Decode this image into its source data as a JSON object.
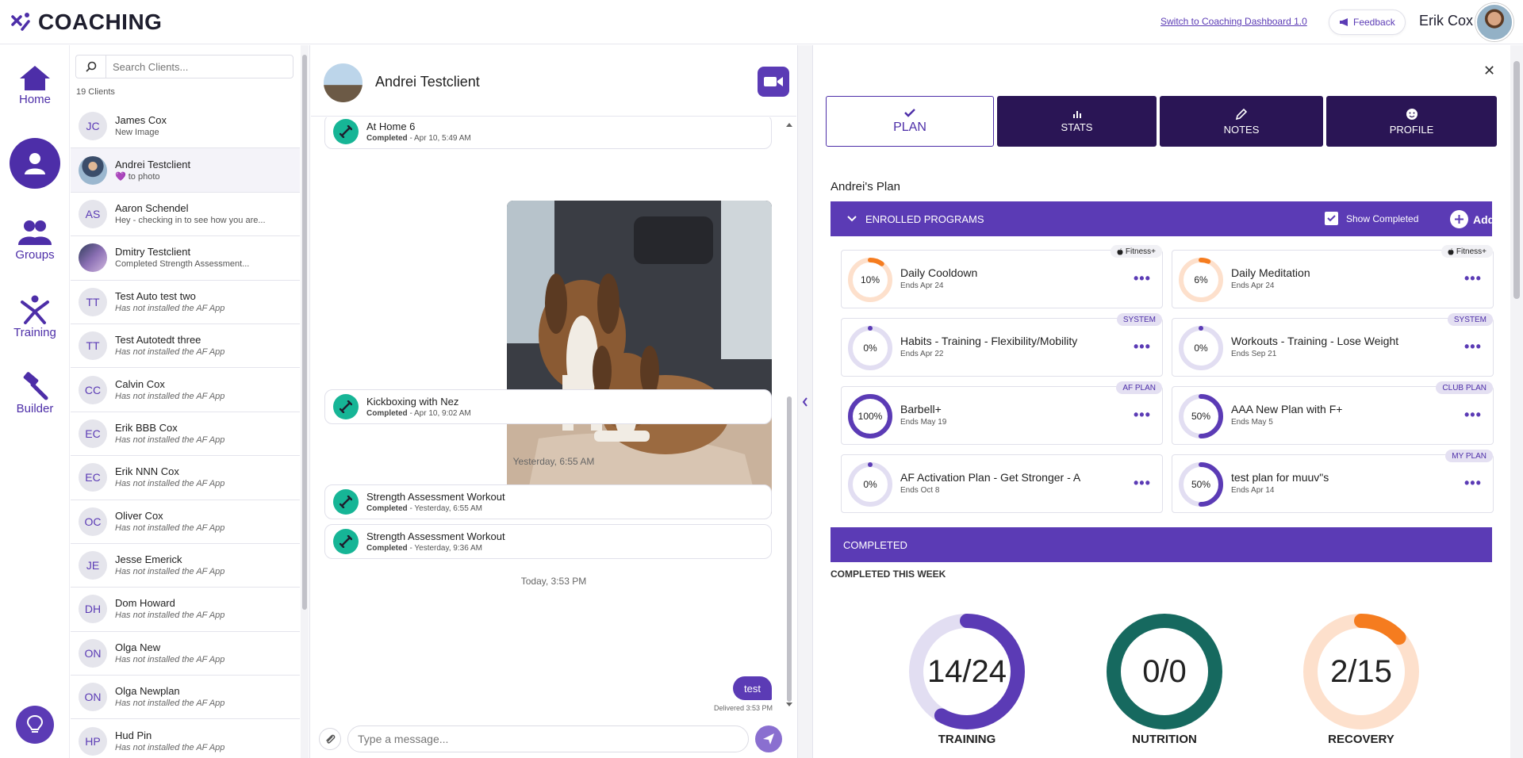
{
  "app": {
    "logo_text": "COACHING",
    "switch_link": "Switch to Coaching Dashboard 1.0",
    "feedback_label": "Feedback",
    "user_name": "Erik Cox"
  },
  "nav": {
    "home": "Home",
    "groups": "Groups",
    "training": "Training",
    "builder": "Builder"
  },
  "clients": {
    "search_placeholder": "Search Clients...",
    "count_label": "19 Clients",
    "items": [
      {
        "initials": "JC",
        "name": "James Cox",
        "sub": "New Image",
        "italic": false
      },
      {
        "initials": "",
        "name": "Andrei Testclient",
        "sub": "💜 to photo",
        "italic": false
      },
      {
        "initials": "AS",
        "name": "Aaron Schendel",
        "sub": "Hey - checking in to see how you are...",
        "italic": false
      },
      {
        "initials": "",
        "name": "Dmitry Testclient",
        "sub": "Completed Strength Assessment...",
        "italic": false
      },
      {
        "initials": "TT",
        "name": "Test Auto test two",
        "sub": "Has not installed the AF App",
        "italic": true
      },
      {
        "initials": "TT",
        "name": "Test Autotedt three",
        "sub": "Has not installed the AF App",
        "italic": true
      },
      {
        "initials": "CC",
        "name": "Calvin Cox",
        "sub": "Has not installed the AF App",
        "italic": true
      },
      {
        "initials": "EC",
        "name": "Erik BBB Cox",
        "sub": "Has not installed the AF App",
        "italic": true
      },
      {
        "initials": "EC",
        "name": "Erik NNN Cox",
        "sub": "Has not installed the AF App",
        "italic": true
      },
      {
        "initials": "OC",
        "name": "Oliver Cox",
        "sub": "Has not installed the AF App",
        "italic": true
      },
      {
        "initials": "JE",
        "name": "Jesse Emerick",
        "sub": "Has not installed the AF App",
        "italic": true
      },
      {
        "initials": "DH",
        "name": "Dom Howard",
        "sub": "Has not installed the AF App",
        "italic": true
      },
      {
        "initials": "ON",
        "name": "Olga New",
        "sub": "Has not installed the AF App",
        "italic": true
      },
      {
        "initials": "ON",
        "name": "Olga Newplan",
        "sub": "Has not installed the AF App",
        "italic": true
      },
      {
        "initials": "HP",
        "name": "Hud Pin",
        "sub": "Has not installed the AF App",
        "italic": true
      }
    ]
  },
  "chat": {
    "client_name": "Andrei Testclient",
    "cards": [
      {
        "title": "At Home 6",
        "status": "Completed",
        "when": " - Apr 10, 5:49 AM"
      },
      {
        "title": "Kickboxing with Nez",
        "status": "Completed",
        "when": " - Apr 10, 9:02 AM"
      },
      {
        "title": "Strength Assessment Workout",
        "status": "Completed",
        "when": " - Yesterday, 6:55 AM"
      },
      {
        "title": "Strength Assessment Workout",
        "status": "Completed",
        "when": " - Yesterday, 9:36 AM"
      }
    ],
    "ts_yesterday": "Yesterday, 6:55 AM",
    "ts_today": "Today, 3:53 PM",
    "message": "test",
    "delivered": "Delivered 3:53 PM",
    "input_placeholder": "Type a message..."
  },
  "plan": {
    "tabs": [
      {
        "label": "PLAN",
        "icon": "check-icon"
      },
      {
        "label": "STATS",
        "icon": "bar-chart-icon"
      },
      {
        "label": "NOTES",
        "icon": "pencil-icon"
      },
      {
        "label": "PROFILE",
        "icon": "smile-icon"
      }
    ],
    "title": "Andrei's Plan",
    "enrolled_label": "ENROLLED PROGRAMS",
    "show_completed_label": "Show Completed",
    "add_label": "Add",
    "programs": [
      {
        "name": "Daily Cooldown",
        "ends": "Ends Apr 24",
        "pct_label": "10%",
        "progress": 0.1,
        "badge": "Fitness+",
        "apple": true,
        "color": "#f57c1f",
        "track": "#fde0cc"
      },
      {
        "name": "Daily Meditation",
        "ends": "Ends Apr 24",
        "pct_label": "6%",
        "progress": 0.06,
        "badge": "Fitness+",
        "apple": true,
        "color": "#f57c1f",
        "track": "#fde0cc"
      },
      {
        "name": "Habits - Training - Flexibility/Mobility",
        "ends": "Ends Apr 22",
        "pct_label": "0%",
        "progress": 0,
        "badge": "SYSTEM",
        "apple": false,
        "color": "#5b3bb5",
        "track": "#e2def2"
      },
      {
        "name": "Workouts - Training - Lose Weight",
        "ends": "Ends Sep 21",
        "pct_label": "0%",
        "progress": 0,
        "badge": "SYSTEM",
        "apple": false,
        "color": "#5b3bb5",
        "track": "#e2def2"
      },
      {
        "name": "Barbell+",
        "ends": "Ends May 19",
        "pct_label": "100%",
        "progress": 1.0,
        "badge": "AF PLAN",
        "apple": false,
        "color": "#5b3bb5",
        "track": "#e2def2"
      },
      {
        "name": "AAA New Plan with F+",
        "ends": "Ends May 5",
        "pct_label": "50%",
        "progress": 0.5,
        "badge": "CLUB PLAN",
        "apple": false,
        "color": "#5b3bb5",
        "track": "#e2def2"
      },
      {
        "name": "AF Activation Plan - Get Stronger - A",
        "ends": "Ends Oct 8",
        "pct_label": "0%",
        "progress": 0,
        "badge": "",
        "apple": false,
        "color": "#5b3bb5",
        "track": "#e2def2"
      },
      {
        "name": "test plan for muuv\"s",
        "ends": "Ends Apr 14",
        "pct_label": "50%",
        "progress": 0.5,
        "badge": "MY PLAN",
        "apple": false,
        "color": "#5b3bb5",
        "track": "#e2def2"
      }
    ],
    "completed_label": "COMPLETED",
    "completed_week_label": "COMPLETED THIS WEEK",
    "stats": [
      {
        "label": "TRAINING",
        "value": "14/24",
        "done": 14,
        "total": 24,
        "color": "#5b3bb5",
        "track": "#e2def2"
      },
      {
        "label": "NUTRITION",
        "value": "0/0",
        "done": 0,
        "total": 0,
        "color": "#16695f",
        "track": "#16695f"
      },
      {
        "label": "RECOVERY",
        "value": "2/15",
        "done": 2,
        "total": 15,
        "color": "#f57c1f",
        "track": "#fde0cc"
      }
    ]
  }
}
